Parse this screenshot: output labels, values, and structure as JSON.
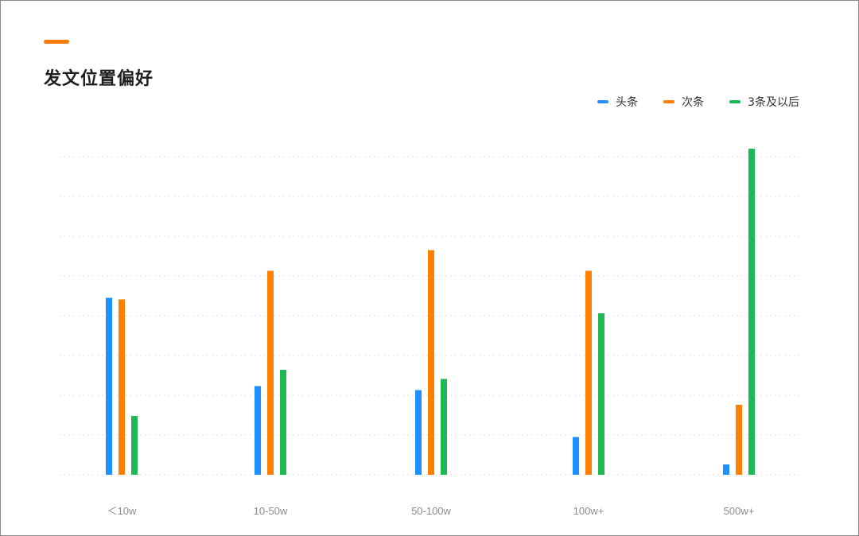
{
  "title": "发文位置偏好",
  "colors": {
    "accent": "#F57C00",
    "toutiao": "#1E90FF",
    "ciitiao": "#FF7F00",
    "after3": "#1DB954",
    "grid": "#DDDDDD"
  },
  "chart_data": {
    "type": "bar",
    "title": "发文位置偏好",
    "categories": [
      "＜10w",
      "10-50w",
      "50-100w",
      "100w+",
      "500w+"
    ],
    "series": [
      {
        "name": "头条",
        "color": "#1E90FF",
        "values": [
          44.5,
          22.3,
          21.3,
          9.5,
          2.6
        ]
      },
      {
        "name": "次条",
        "color": "#FF7F00",
        "values": [
          44.1,
          51.3,
          56.5,
          51.3,
          17.6
        ]
      },
      {
        "name": "3条及以后",
        "color": "#1DB954",
        "values": [
          14.8,
          26.4,
          24.1,
          40.6,
          82
        ]
      }
    ],
    "ylim": [
      0,
      80
    ],
    "grid": true,
    "legend": "top-right"
  }
}
